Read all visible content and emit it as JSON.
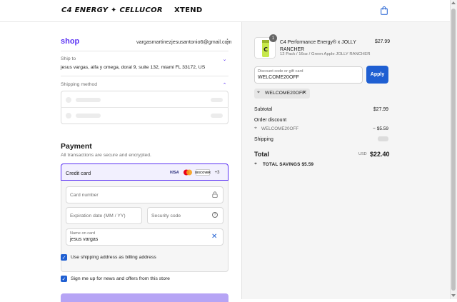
{
  "header": {
    "brands": [
      "C4 ENERGY",
      "CELLUCOR",
      "XTEND"
    ],
    "cart_icon": "shopping-bag-icon"
  },
  "contact": {
    "shop_label": "shop",
    "email": "vargasmartinezjesusantonio6@gmail.com"
  },
  "ship_to": {
    "label": "Ship to",
    "address": "jesus vargas, alfa y omega, doral 9, suite 132, miami FL 33172, US"
  },
  "shipping_method": {
    "label": "Shipping method"
  },
  "payment": {
    "title": "Payment",
    "subtitle": "All transactions are secure and encrypted.",
    "method_label": "Credit card",
    "card_brands": [
      "VISA",
      "Mastercard",
      "DISCOVER"
    ],
    "more_brands": "+3",
    "card_number_placeholder": "Card number",
    "expiration_placeholder": "Expiration date (MM / YY)",
    "security_placeholder": "Security code",
    "name_label": "Name on card",
    "name_value": "jesus vargas",
    "billing_checkbox": "Use shipping address as billing address",
    "news_checkbox": "Sign me up for news and offers from this store"
  },
  "order": {
    "quantity": "1",
    "product_name": "C4 Performance Energy® x JOLLY RANCHER",
    "variant": "12 Pack / 16oz / Green Apple JOLLY RANCHER",
    "price": "$27.99",
    "discount_placeholder": "Discount code or gift card",
    "discount_value": "WELCOME20OFF",
    "apply_label": "Apply",
    "chip_code": "WELCOME20OFF",
    "subtotal_label": "Subtotal",
    "subtotal_value": "$27.99",
    "order_discount_label": "Order discount",
    "discount_code": "WELCOME20OFF",
    "discount_amount": "− $5.59",
    "shipping_label": "Shipping",
    "total_label": "Total",
    "currency": "USD",
    "total_value": "$22.40",
    "savings_label": "TOTAL SAVINGS",
    "savings_value": "$5.59"
  },
  "colors": {
    "accent": "#5a31f4",
    "button": "#1f5fd2"
  }
}
